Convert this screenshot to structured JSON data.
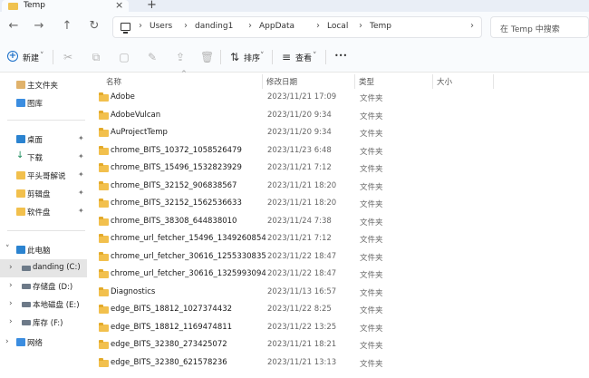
{
  "tab": {
    "title": "Temp",
    "close_icon": "×",
    "new_tab_icon": "+"
  },
  "nav": {
    "back": "←",
    "forward": "→",
    "up": "↑",
    "refresh": "↻"
  },
  "breadcrumb": [
    "Users",
    "danding1",
    "AppData",
    "Local",
    "Temp"
  ],
  "search": {
    "placeholder": "在 Temp 中搜索"
  },
  "toolbar": {
    "new_label": "新建",
    "sort_label": "排序",
    "view_label": "查看",
    "more_label": "•••",
    "icons": [
      "cut-icon",
      "copy-icon",
      "paste-icon",
      "rename-icon",
      "share-icon",
      "delete-icon"
    ]
  },
  "sidebar": {
    "top": [
      {
        "label": "主文件夹",
        "icon": "home-icon"
      },
      {
        "label": "图库",
        "icon": "gallery-icon"
      }
    ],
    "pinned": [
      {
        "label": "桌面",
        "icon": "desktop-icon"
      },
      {
        "label": "下载",
        "icon": "download-icon"
      },
      {
        "label": "平头哥解说",
        "icon": "folder-icon"
      },
      {
        "label": "剪辑盘",
        "icon": "folder-icon"
      },
      {
        "label": "软件盘",
        "icon": "folder-icon"
      }
    ],
    "this_pc": "此电脑",
    "drives": [
      {
        "label": "danding (C:)",
        "selected": true
      },
      {
        "label": "存储盘 (D:)",
        "selected": false
      },
      {
        "label": "本地磁盘 (E:)",
        "selected": false
      },
      {
        "label": "库存 (F:)",
        "selected": false
      }
    ],
    "network": "网络"
  },
  "columns": {
    "name": "名称",
    "date": "修改日期",
    "type": "类型",
    "size": "大小"
  },
  "files": [
    {
      "name": "Adobe",
      "date": "2023/11/21 17:09",
      "type": "文件夹"
    },
    {
      "name": "AdobeVulcan",
      "date": "2023/11/20 9:34",
      "type": "文件夹"
    },
    {
      "name": "AuProjectTemp",
      "date": "2023/11/20 9:34",
      "type": "文件夹"
    },
    {
      "name": "chrome_BITS_10372_1058526479",
      "date": "2023/11/23 6:48",
      "type": "文件夹"
    },
    {
      "name": "chrome_BITS_15496_1532823929",
      "date": "2023/11/21 7:12",
      "type": "文件夹"
    },
    {
      "name": "chrome_BITS_32152_906838567",
      "date": "2023/11/21 18:20",
      "type": "文件夹"
    },
    {
      "name": "chrome_BITS_32152_1562536633",
      "date": "2023/11/21 18:20",
      "type": "文件夹"
    },
    {
      "name": "chrome_BITS_38308_644838010",
      "date": "2023/11/24 7:38",
      "type": "文件夹"
    },
    {
      "name": "chrome_url_fetcher_15496_1349260854",
      "date": "2023/11/21 7:12",
      "type": "文件夹"
    },
    {
      "name": "chrome_url_fetcher_30616_1255330835",
      "date": "2023/11/22 18:47",
      "type": "文件夹"
    },
    {
      "name": "chrome_url_fetcher_30616_1325993094",
      "date": "2023/11/22 18:47",
      "type": "文件夹"
    },
    {
      "name": "Diagnostics",
      "date": "2023/11/13 16:57",
      "type": "文件夹"
    },
    {
      "name": "edge_BITS_18812_1027374432",
      "date": "2023/11/22 8:25",
      "type": "文件夹"
    },
    {
      "name": "edge_BITS_18812_1169474811",
      "date": "2023/11/22 13:25",
      "type": "文件夹"
    },
    {
      "name": "edge_BITS_32380_273425072",
      "date": "2023/11/21 18:21",
      "type": "文件夹"
    },
    {
      "name": "edge_BITS_32380_621578236",
      "date": "2023/11/21 13:13",
      "type": "文件夹"
    }
  ]
}
